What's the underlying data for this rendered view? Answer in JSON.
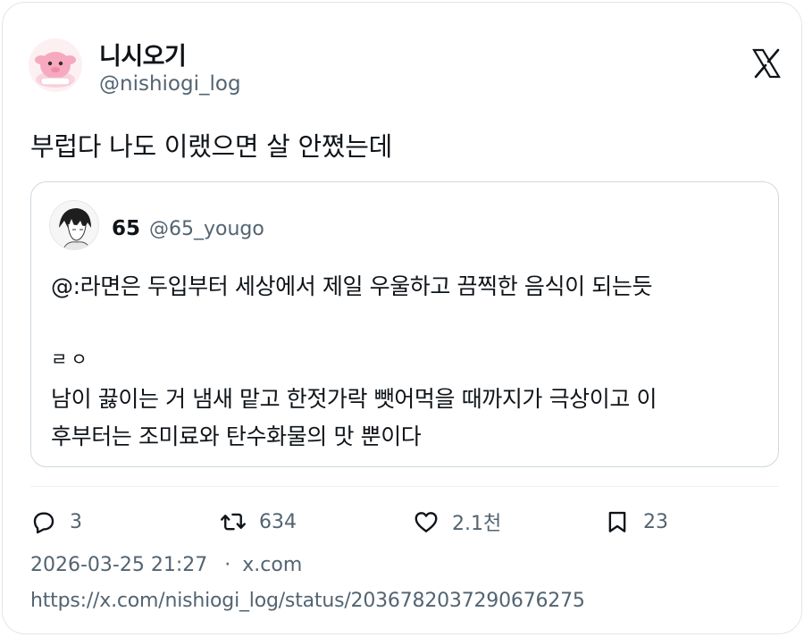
{
  "author": {
    "display_name": "니시오기",
    "handle": "@nishiogi_log",
    "avatar": "pink-character-avatar"
  },
  "platform": {
    "logo": "x-logo-icon"
  },
  "tweet": {
    "text": "부럽다 나도 이랬으면 살 안쪘는데"
  },
  "quoted_tweet": {
    "display_name": "65",
    "handle": "@65_yougo",
    "avatar": "anime-portrait-avatar",
    "lines": [
      "@:라면은 두입부터 세상에서 제일 우울하고 끔찍한 음식이 되는듯",
      "ㄹㅇ",
      "남이 끓이는 거 냄새 맡고 한젓가락 뺏어먹을 때까지가 극상이고 이",
      "후부터는 조미료와 탄수화물의 맛 뿐이다"
    ]
  },
  "actions": {
    "replies": {
      "icon": "reply-icon",
      "count": "3"
    },
    "retweets": {
      "icon": "retweet-icon",
      "count": "634"
    },
    "likes": {
      "icon": "heart-icon",
      "count": "2.1천"
    },
    "bookmarks": {
      "icon": "bookmark-icon",
      "count": "23"
    }
  },
  "meta": {
    "timestamp": "2026-03-25 21:27",
    "separator": "·",
    "source": "x.com",
    "url": "https://x.com/nishiogi_log/status/2036782037290676275"
  },
  "colors": {
    "text": "#0f1419",
    "secondary": "#536471",
    "border": "#cfd9de"
  }
}
